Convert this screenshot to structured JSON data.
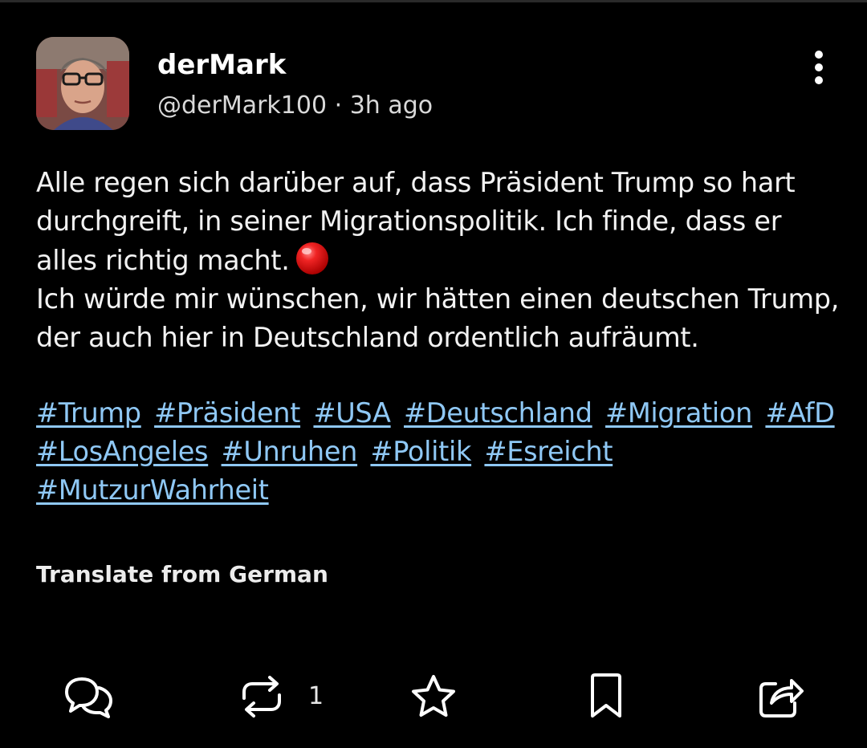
{
  "post": {
    "author": {
      "display_name": "derMark",
      "handle": "@derMark100",
      "separator": "·",
      "time_ago": "3h ago"
    },
    "text_lines": [
      "Alle regen sich darüber auf, dass Präsident Trump so hart durchgreift, in seiner Migrationspolitik. Ich finde, dass er alles richtig macht.",
      "Ich würde mir wünschen, wir hätten einen deutschen Trump, der auch hier in Deutschland ordentlich aufräumt."
    ],
    "inline_emoji": "red-circle-icon",
    "hashtags": [
      "#Trump",
      "#Präsident",
      "#USA",
      "#Deutschland",
      "#Migration",
      "#AfD",
      "#LosAngeles",
      "#Unruhen",
      "#Politik",
      "#Esreicht",
      "#MutzurWahrheit"
    ],
    "translate_label": "Translate from German"
  },
  "actions": {
    "reply_icon": "reply-icon",
    "repost_icon": "repost-icon",
    "repost_count": "1",
    "like_icon": "star-icon",
    "bookmark_icon": "bookmark-icon",
    "share_icon": "share-icon",
    "more_icon": "more-vertical-icon"
  },
  "colors": {
    "background": "#000000",
    "text": "#f2f2f2",
    "hashtag": "#8fc8f5",
    "emoji_red": "#e01010"
  }
}
